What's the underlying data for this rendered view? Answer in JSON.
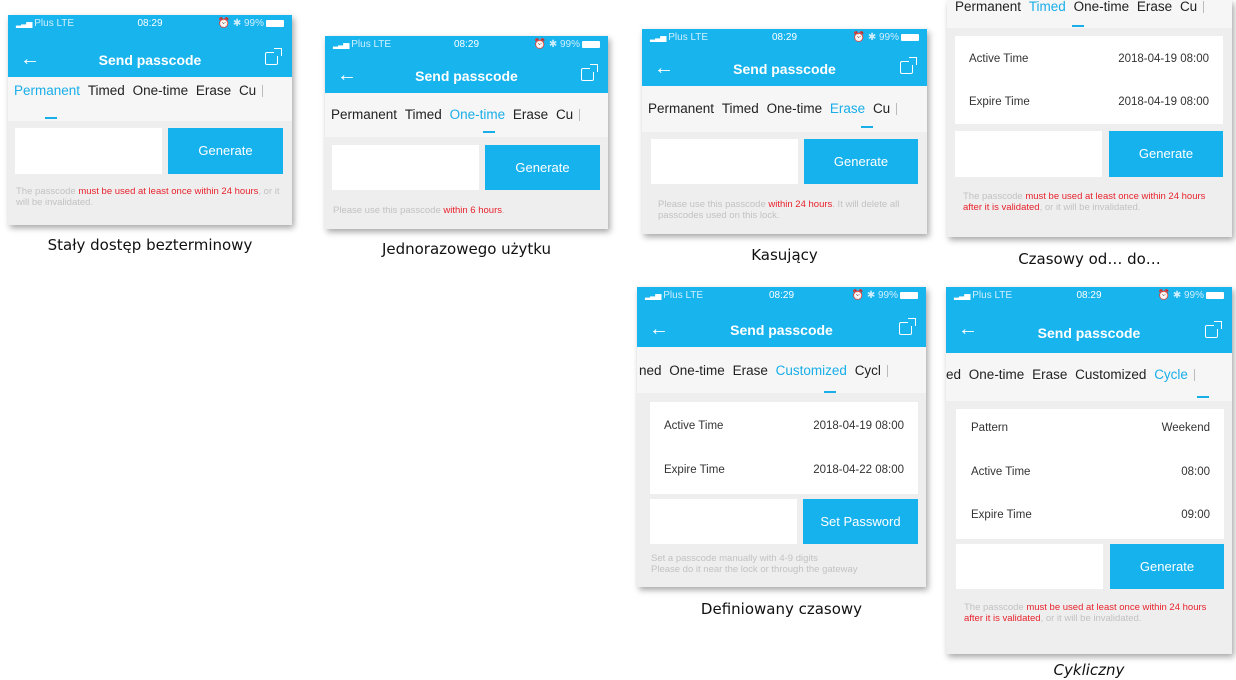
{
  "status": {
    "carrier": "Plus  LTE",
    "time": "08:29",
    "battery": "99%"
  },
  "nav": {
    "title": "Send passcode"
  },
  "tabs": {
    "permanent": "Permanent",
    "timed": "Timed",
    "onetime": "One-time",
    "erase": "Erase",
    "cu": "Cu",
    "customized": "Customized",
    "cycle": "Cycle",
    "cycl": "Cycl",
    "ned": "ned",
    "ed": "ed"
  },
  "buttons": {
    "generate": "Generate",
    "set_password": "Set Password"
  },
  "fields": {
    "active_time": "Active Time",
    "expire_time": "Expire Time",
    "pattern": "Pattern"
  },
  "values": {
    "timed_active": "2018-04-19 08:00",
    "timed_expire": "2018-04-19 08:00",
    "custom_active": "2018-04-19 08:00",
    "custom_expire": "2018-04-22 08:00",
    "cycle_pattern": "Weekend",
    "cycle_active": "08:00",
    "cycle_expire": "09:00"
  },
  "notes": {
    "permanent_a": "The passcode ",
    "permanent_red": "must be used at least once within 24 hours",
    "permanent_b": ", or it will be invalidated.",
    "onetime_a": "Please use this passcode ",
    "onetime_red": "within 6 hours",
    "onetime_b": ".",
    "erase_a": "Please use this passcode ",
    "erase_red": "within 24 hours",
    "erase_b": ". It will delete all passcodes used on this lock.",
    "timed_a": "The passcode ",
    "timed_red": "must be used at least once within 24 hours after it is validated",
    "timed_b": ", or it will be invalidated.",
    "custom_line1": "Set a passcode manually with 4-9 digits",
    "custom_line2": "Please do it near the lock or  through the gateway"
  },
  "captions": {
    "permanent": "Stały dostęp bezterminowy",
    "onetime": "Jednorazowego użytku",
    "erase": "Kasujący",
    "timed": "Czasowy od… do…",
    "customized": "Definiowany czasowy",
    "cycle": "Cykliczny"
  },
  "colors": {
    "accent": "#18b4ee",
    "warning": "#e8222b"
  }
}
